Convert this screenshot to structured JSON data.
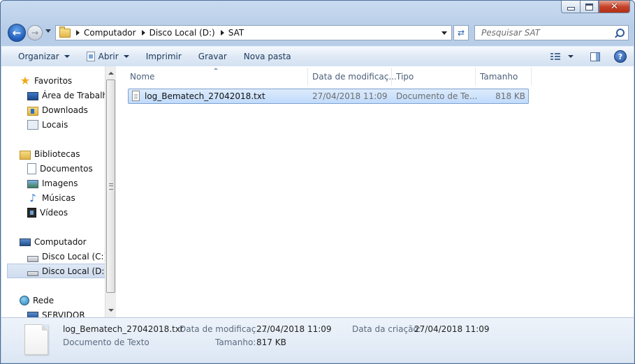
{
  "address": {
    "crumbs": [
      "Computador",
      "Disco Local (D:)",
      "SAT"
    ]
  },
  "search": {
    "placeholder": "Pesquisar SAT"
  },
  "toolbar": {
    "organize": "Organizar",
    "open": "Abrir",
    "print": "Imprimir",
    "burn": "Gravar",
    "new_folder": "Nova pasta"
  },
  "nav": {
    "favorites": "Favoritos",
    "desktop": "Área de Trabalho",
    "downloads": "Downloads",
    "places": "Locais",
    "libraries": "Bibliotecas",
    "documents": "Documentos",
    "pictures": "Imagens",
    "music": "Músicas",
    "videos": "Vídeos",
    "computer": "Computador",
    "drive_c": "Disco Local (C:)",
    "drive_d": "Disco Local (D:)",
    "network": "Rede",
    "server": "SERVIDOR"
  },
  "columns": {
    "name": "Nome",
    "modified": "Data de modificaç...",
    "type": "Tipo",
    "size": "Tamanho"
  },
  "files": [
    {
      "name": "log_Bematech_27042018.txt",
      "modified": "27/04/2018 11:09",
      "type": "Documento de Te...",
      "size": "818 KB"
    }
  ],
  "details": {
    "name": "log_Bematech_27042018.txt",
    "type": "Documento de Texto",
    "modified_label": "Data de modificaç...:",
    "modified_value": "27/04/2018 11:09",
    "size_label": "Tamanho:",
    "size_value": "817 KB",
    "created_label": "Data da criação:",
    "created_value": "27/04/2018 11:09"
  }
}
